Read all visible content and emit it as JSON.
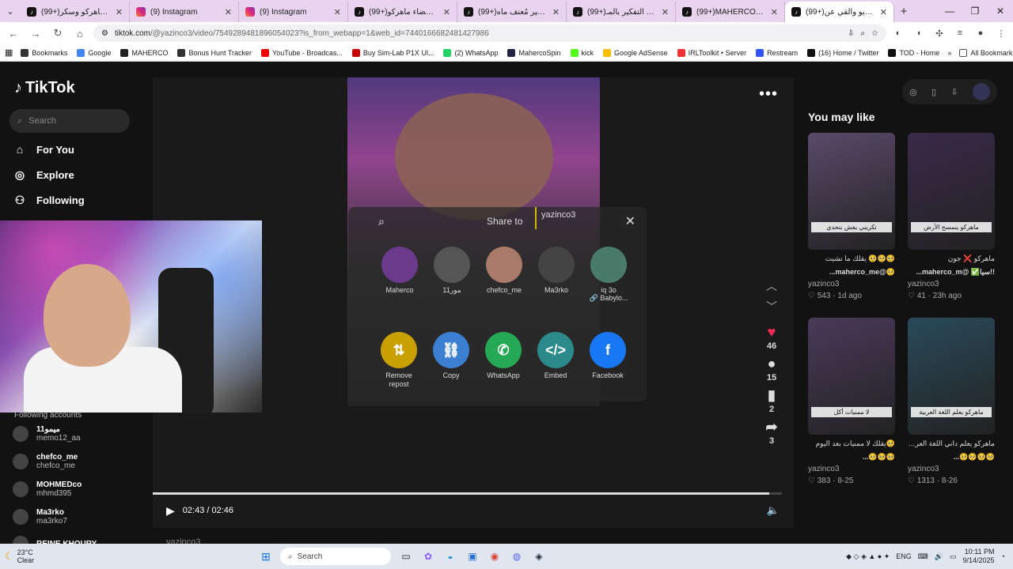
{
  "browser": {
    "tabs": [
      {
        "title": "(99+)شكراً يا ماهركو وسكر",
        "icon": "tiktok"
      },
      {
        "title": "(9) Instagram",
        "icon": "instagram"
      },
      {
        "title": "(9) Instagram",
        "icon": "instagram"
      },
      {
        "title": "(99+)حصرياً لأعضاء ماهركو",
        "icon": "tiktok"
      },
      {
        "title": "(99+)الفقير مُعنف ماه",
        "icon": "tiktok"
      },
      {
        "title": "(99+)والله بس التفكير بالمـ",
        "icon": "tiktok"
      },
      {
        "title": "(99+)MAHERCO#ريبة",
        "icon": "tiktok"
      },
      {
        "title": "(99+)فيديو والقي عن",
        "icon": "tiktok"
      }
    ],
    "url_host": "tiktok.com",
    "url_path": "/@yazinco3/video/7549289481896054023?is_from_webapp=1&web_id=7440166682481427986",
    "bookmarks": [
      {
        "label": "Bookmarks",
        "color": "#333"
      },
      {
        "label": "Google",
        "color": "#4285f4"
      },
      {
        "label": "MAHERCO",
        "color": "#222"
      },
      {
        "label": "Bonus Hunt Tracker",
        "color": "#333"
      },
      {
        "label": "YouTube - Broadcas...",
        "color": "#e00"
      },
      {
        "label": "Buy Sim-Lab P1X Ul...",
        "color": "#c00"
      },
      {
        "label": "(2) WhatsApp",
        "color": "#25d366"
      },
      {
        "label": "MahercoSpin",
        "color": "#224"
      },
      {
        "label": "kick",
        "color": "#53fc18"
      },
      {
        "label": "Google AdSense",
        "color": "#fbbc04"
      },
      {
        "label": "IRLToolkit • Server",
        "color": "#e33"
      },
      {
        "label": "Restream",
        "color": "#3355ff"
      },
      {
        "label": "(16) Home / Twitter",
        "color": "#111"
      },
      {
        "label": "TOD - Home",
        "color": "#111"
      }
    ],
    "all_bookmarks": "All Bookmarks"
  },
  "sidebar": {
    "logo": "TikTok",
    "search_placeholder": "Search",
    "nav": [
      {
        "label": "For You",
        "icon": "home-icon",
        "glyph": "⌂"
      },
      {
        "label": "Explore",
        "icon": "compass-icon",
        "glyph": "◎"
      },
      {
        "label": "Following",
        "icon": "people-icon",
        "glyph": "⚇"
      }
    ],
    "following_title": "Following accounts",
    "following": [
      {
        "name": "ميمو11",
        "handle": "memo12_aa"
      },
      {
        "name": "chefco_me",
        "handle": "chefco_me"
      },
      {
        "name": "MOHMEDco",
        "handle": "mhmd395"
      },
      {
        "name": "Ma3rko",
        "handle": "ma3rko7"
      },
      {
        "name": "REINE KHOURY",
        "handle": ""
      }
    ]
  },
  "video": {
    "time": "02:43 / 02:46",
    "progress": 0.98,
    "below_user": "yazinco3",
    "likes": "46",
    "comments": "15",
    "saves": "2",
    "shares": "3"
  },
  "share": {
    "title": "Share to",
    "user": "yazinco3",
    "contacts": [
      {
        "label": "Maherco",
        "color": "#6b3a8a"
      },
      {
        "label": "11مور",
        "color": "#555"
      },
      {
        "label": "chefco_me",
        "color": "#a87a6a"
      },
      {
        "label": "Ma3rko",
        "color": "#444"
      },
      {
        "label": "iq 3o\n🔗 Babylo...",
        "color": "#4a7a6a"
      }
    ],
    "actions": [
      {
        "label": "Remove repost",
        "glyph": "⇅",
        "color": "#c9a000"
      },
      {
        "label": "Copy",
        "glyph": "⛓",
        "color": "#3b7fd0"
      },
      {
        "label": "WhatsApp",
        "glyph": "✆",
        "color": "#25a955"
      },
      {
        "label": "Embed",
        "glyph": "</>",
        "color": "#2c8a8a"
      },
      {
        "label": "Facebook",
        "glyph": "f",
        "color": "#1877f2"
      }
    ]
  },
  "you_may_like": {
    "title": "You may like",
    "cards": [
      {
        "caption": "تكريني يفش بتحدي",
        "desc": "🥺🥺🥺 يقلك ما تشيت",
        "extra": "🥺@maherco_me...",
        "author": "yazinco3",
        "likes": "543",
        "date": "1d ago",
        "bg": "#5a4a6a"
      },
      {
        "caption": "ماهركو ينمسح الأرض",
        "desc": "ماهركو ❌ جون",
        "extra": "!!سيا✅ @maherco_m...",
        "author": "yazinco3",
        "likes": "41",
        "date": "23h ago",
        "bg": "#3a2a4a"
      },
      {
        "caption": "لا ممنيات أكل",
        "desc": "🥺يقلك لا ممنيات بعد اليوم",
        "extra": "🥺🥺🥺...",
        "author": "yazinco3",
        "likes": "383",
        "date": "8-25",
        "bg": "#4a3a5a"
      },
      {
        "caption": "ماهركو يعلم اللغة العربية",
        "desc": "ماهركو يعلم داني اللغة العربية",
        "extra": "🥺🥺🥺🥺...",
        "author": "yazinco3",
        "likes": "1313",
        "date": "8-26",
        "bg": "#2a4a5a"
      }
    ]
  },
  "taskbar": {
    "temp": "23°C",
    "weather": "Clear",
    "search": "Search",
    "lang": "ENG",
    "time": "10:11 PM",
    "date": "9/14/2025"
  }
}
